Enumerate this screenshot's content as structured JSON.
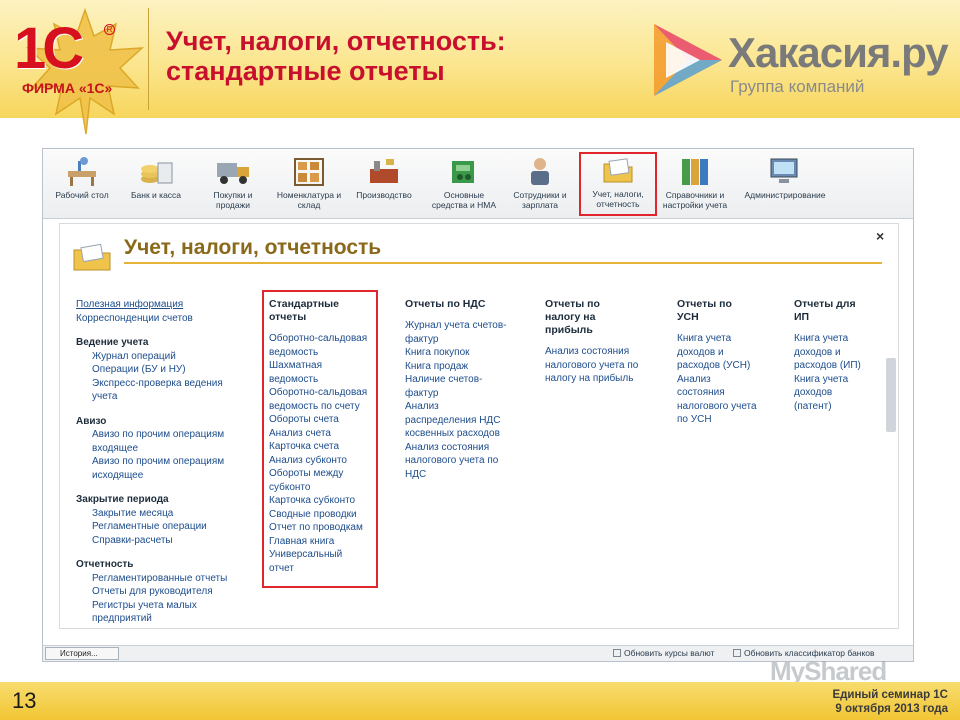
{
  "slide": {
    "title_line1": "Учет, налоги, отчетность:",
    "title_line2": "стандартные отчеты",
    "logo_text": "1С",
    "firma_text": "ФИРМА «1С»",
    "partner_name": "Хакасия.ру",
    "partner_subtitle": "Группа компаний",
    "page_number": "13",
    "footer_line1": "Единый семинар 1С",
    "footer_line2": "9 октября 2013 года",
    "watermark": "MyShared"
  },
  "toolbar": {
    "items": [
      {
        "label": "Рабочий стол",
        "icon": "desk-icon"
      },
      {
        "label": "Банк и касса",
        "icon": "coins-icon"
      },
      {
        "label": "Покупки и продажи",
        "icon": "truck-icon"
      },
      {
        "label": "Номенклатура и склад",
        "icon": "warehouse-icon"
      },
      {
        "label": "Производство",
        "icon": "factory-icon"
      },
      {
        "label": "Основные средства и НМА",
        "icon": "equipment-icon"
      },
      {
        "label": "Сотрудники и зарплата",
        "icon": "employee-icon"
      },
      {
        "label": "Учет, налоги, отчетность",
        "icon": "report-icon",
        "active": true
      },
      {
        "label": "Справочники и настройки учета",
        "icon": "binders-icon"
      },
      {
        "label": "Администрирование",
        "icon": "computer-icon"
      }
    ]
  },
  "section": {
    "title": "Учет, налоги, отчетность",
    "close": "×"
  },
  "left_nav": {
    "top_links": [
      "Полезная информация",
      "Корреспонденции счетов"
    ],
    "groups": [
      {
        "title": "Ведение учета",
        "items": [
          "Журнал операций",
          "Операции (БУ и НУ)",
          "Экспресс-проверка ведения",
          "учета"
        ]
      },
      {
        "title": "Авизо",
        "items": [
          "Авизо по прочим операциям",
          "входящее",
          "Авизо по прочим операциям",
          "исходящее"
        ]
      },
      {
        "title": "Закрытие периода",
        "items": [
          "Закрытие месяца",
          "Регламентные операции",
          "Справки-расчеты"
        ]
      },
      {
        "title": "Отчетность",
        "items": [
          "Регламентированные отчеты",
          "Отчеты для руководителя",
          "Регистры учета малых",
          "предприятий"
        ]
      }
    ]
  },
  "columns": {
    "standard": {
      "title": [
        "Стандартные",
        "отчеты"
      ],
      "items": [
        "Оборотно-сальдовая",
        "ведомость",
        "Шахматная",
        "ведомость",
        "Оборотно-сальдовая",
        "ведомость по счету",
        "Обороты счета",
        "Анализ счета",
        "Карточка счета",
        "Анализ субконто",
        "Обороты между",
        "субконто",
        "Карточка субконто",
        "Сводные проводки",
        "Отчет по проводкам",
        "Главная книга",
        "Универсальный",
        "отчет"
      ]
    },
    "vat": {
      "title": [
        "Отчеты по НДС"
      ],
      "items": [
        "Журнал учета счетов-",
        "фактур",
        "Книга покупок",
        "Книга продаж",
        "Наличие счетов-",
        "фактур",
        "Анализ",
        "распределения НДС",
        "косвенных расходов",
        "Анализ состояния",
        "налогового учета по",
        "НДС"
      ]
    },
    "profit": {
      "title": [
        "Отчеты по",
        "налогу на",
        "прибыль"
      ],
      "items": [
        "Анализ состояния",
        "налогового учета по",
        "налогу на прибыль"
      ]
    },
    "usn": {
      "title": [
        "Отчеты по",
        "УСН"
      ],
      "items": [
        "Книга учета",
        "доходов и",
        "расходов (УСН)",
        "Анализ",
        "состояния",
        "налогового учета",
        "по УСН"
      ]
    },
    "ip": {
      "title": [
        "Отчеты для",
        "ИП"
      ],
      "items": [
        "Книга учета",
        "доходов и",
        "расходов (ИП)",
        "Книга учета",
        "доходов",
        "(патент)"
      ]
    }
  },
  "status_bar": {
    "history_label": "История...",
    "link1": "Обновить курсы валют",
    "link2": "Обновить классификатор банков"
  },
  "colors": {
    "title_red": "#c8102e",
    "highlight_red": "#e0262c",
    "link_blue": "#1d4d8c",
    "header_yellow": "#fbe58e"
  }
}
